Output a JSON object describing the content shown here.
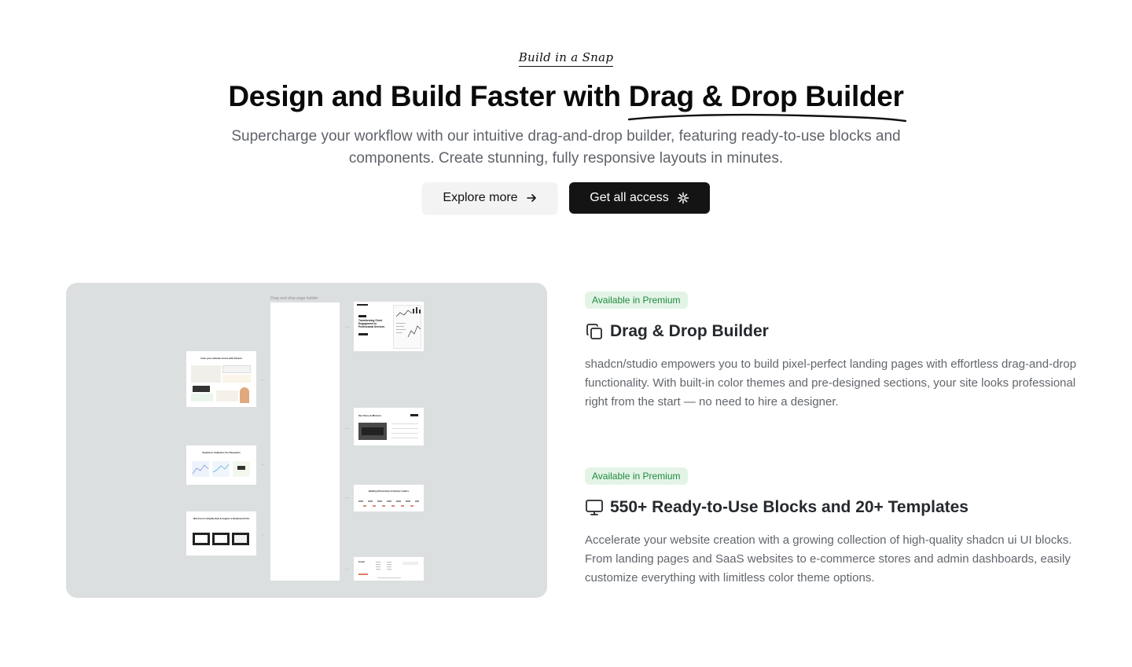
{
  "hero": {
    "eyebrow": "Build in a Snap",
    "title_prefix": "Design and Build Faster with ",
    "title_highlight": "Drag & Drop Builder",
    "subtitle": "Supercharge your workflow with our intuitive drag-and-drop builder, featuring ready-to-use blocks and components. Create stunning, fully responsive layouts in minutes.",
    "explore_label": "Explore more",
    "access_label": "Get all access"
  },
  "preview": {
    "canvas_label": "Drag and drop page builder",
    "thumbs": {
      "hero": "Transforming Client Engagement to Professional Services",
      "website": "Give your website boost with Flowrit",
      "seamless": "Seamless Analytics For Payments",
      "dashboard": "Web Form to Simplify Data & Insights to Dashboard UI Kit",
      "story": "Our Story & Mission",
      "partners": "Building Partnerships & Industry Leaders",
      "footer": "Footer"
    }
  },
  "features": [
    {
      "badge": "Available in Premium",
      "icon": "copy-icon",
      "title": "Drag & Drop Builder",
      "description": "shadcn/studio empowers you to build pixel-perfect landing pages with effortless drag-and-drop functionality. With built-in color themes and pre-designed sections, your site looks professional right from the start — no need to hire a designer."
    },
    {
      "badge": "Available in Premium",
      "icon": "monitor-icon",
      "title": "550+ Ready-to-Use Blocks and 20+ Templates",
      "description": "Accelerate your website creation with a growing collection of high-quality shadcn ui UI blocks. From landing pages and SaaS websites to e-commerce stores and admin dashboards, easily customize everything with limitless color theme options."
    }
  ],
  "colors": {
    "badge_bg": "#e3f4e7",
    "badge_text": "#1f8a3e",
    "primary_button": "#141414",
    "preview_bg": "#dcdfe0"
  }
}
